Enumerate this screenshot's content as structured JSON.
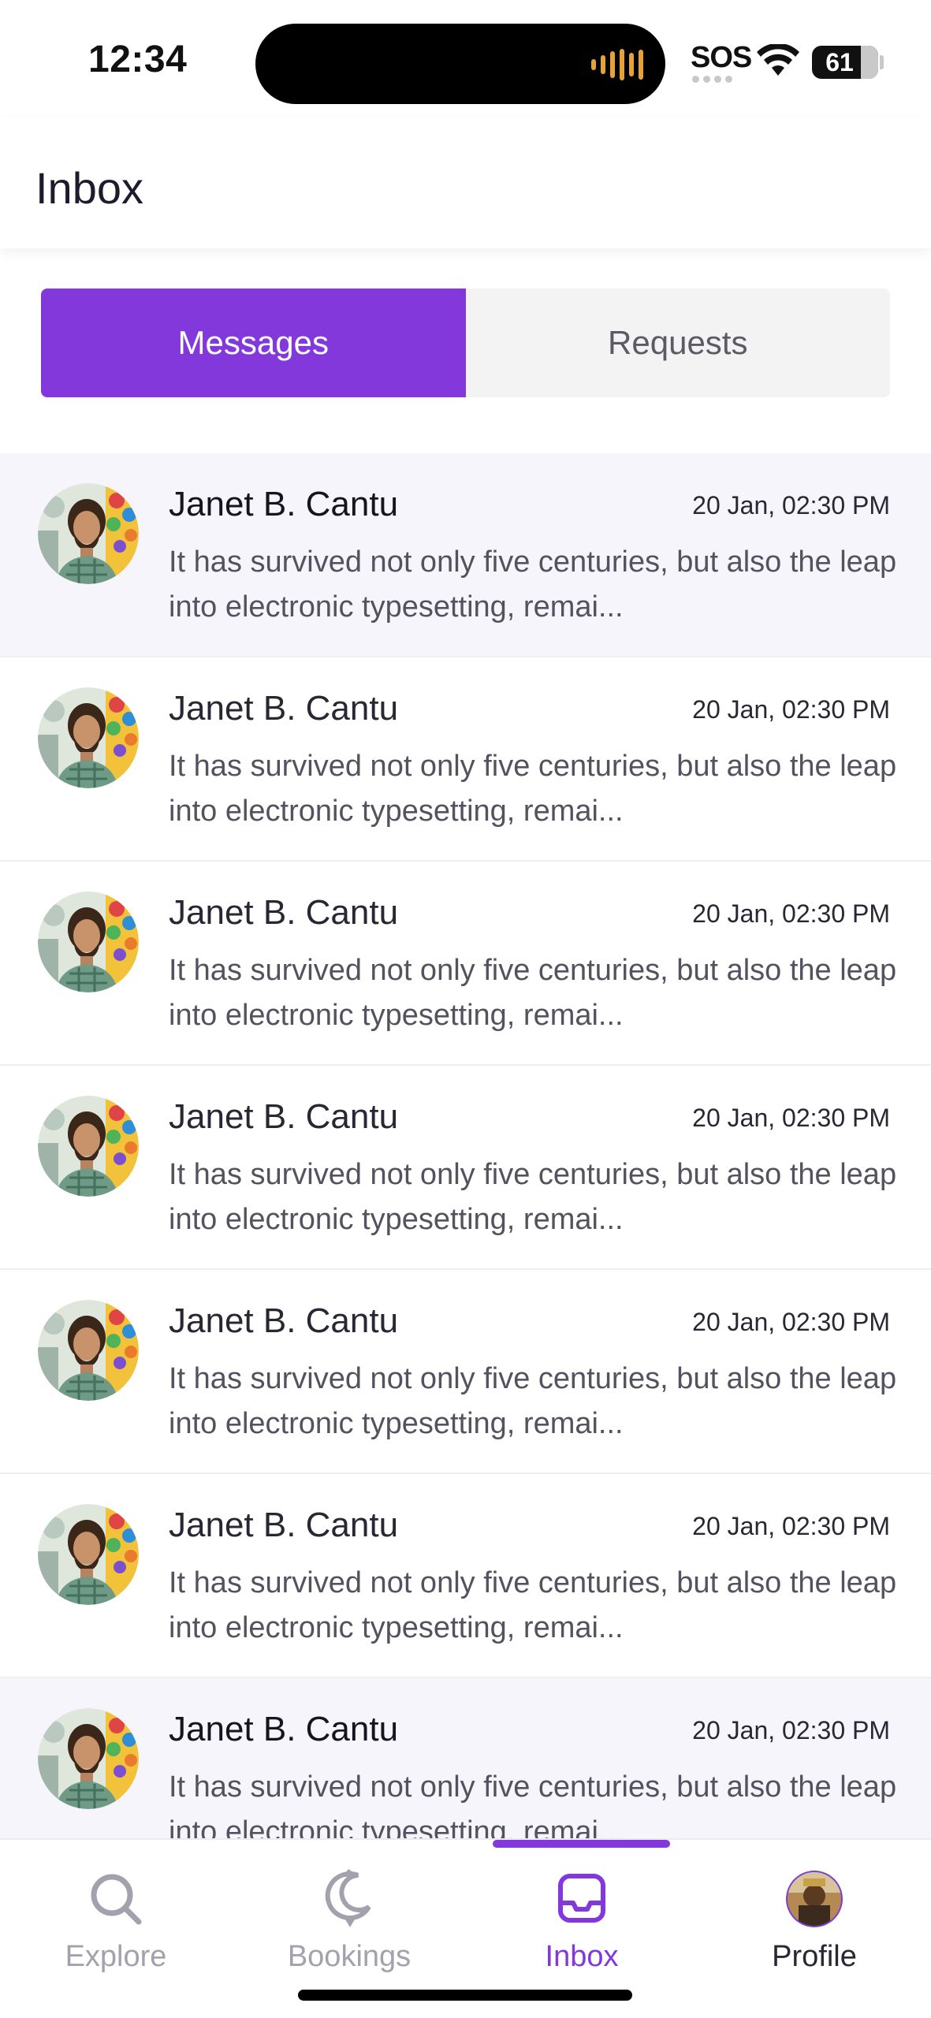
{
  "status_bar": {
    "time": "12:34",
    "carrier": "SOS",
    "battery": "61"
  },
  "header": {
    "title": "Inbox"
  },
  "tabs": [
    {
      "label": "Messages",
      "active": true
    },
    {
      "label": "Requests",
      "active": false
    }
  ],
  "messages": [
    {
      "name": "Janet B. Cantu",
      "time": "20 Jan, 02:30 PM",
      "preview": "It has survived not only five centuries, but also the leap into electronic typesetting, remai..."
    },
    {
      "name": "Janet B. Cantu",
      "time": "20 Jan, 02:30 PM",
      "preview": "It has survived not only five centuries, but also the leap into electronic typesetting, remai..."
    },
    {
      "name": "Janet B. Cantu",
      "time": "20 Jan, 02:30 PM",
      "preview": "It has survived not only five centuries, but also the leap into electronic typesetting, remai..."
    },
    {
      "name": "Janet B. Cantu",
      "time": "20 Jan, 02:30 PM",
      "preview": "It has survived not only five centuries, but also the leap into electronic typesetting, remai..."
    },
    {
      "name": "Janet B. Cantu",
      "time": "20 Jan, 02:30 PM",
      "preview": "It has survived not only five centuries, but also the leap into electronic typesetting, remai..."
    },
    {
      "name": "Janet B. Cantu",
      "time": "20 Jan, 02:30 PM",
      "preview": "It has survived not only five centuries, but also the leap into electronic typesetting, remai..."
    },
    {
      "name": "Janet B. Cantu",
      "time": "20 Jan, 02:30 PM",
      "preview": "It has survived not only five centuries, but also the leap into electronic typesetting, remai..."
    }
  ],
  "bottom_nav": [
    {
      "label": "Explore",
      "icon": "search-icon",
      "active": false
    },
    {
      "label": "Bookings",
      "icon": "bookings-icon",
      "active": false
    },
    {
      "label": "Inbox",
      "icon": "inbox-icon",
      "active": true
    },
    {
      "label": "Profile",
      "icon": "profile-avatar",
      "active": false
    }
  ],
  "colors": {
    "accent": "#8338dc",
    "highlight_row": "#f7f5fc",
    "inactive_nav": "#a3a1ad"
  }
}
